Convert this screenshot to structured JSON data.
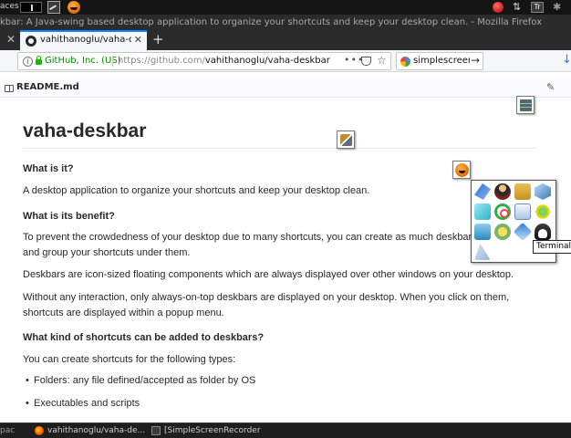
{
  "os_panel": {
    "workspaces_label": "aces",
    "tray": [
      "record-icon",
      "network-icon",
      "keyboard-icon",
      "bluetooth-icon"
    ],
    "keyboard_layout": "Tr"
  },
  "window": {
    "title": "kbar: A Java-swing based desktop application to organize your shortcuts and keep your desktop clean. - Mozilla Firefox"
  },
  "tabs": [
    {
      "title": "vahithanoglu/vaha-deskb",
      "active": true
    }
  ],
  "nav": {
    "identity": "GitHub, Inc. (US)",
    "url_host": "https://github.com/",
    "url_path": "vahithanoglu/vaha-deskbar",
    "page_actions": "•••",
    "search_value": "simplescreenrecorder"
  },
  "readme": {
    "filename": "README.md",
    "title": "vaha-deskbar",
    "sections": [
      {
        "heading": "What is it?",
        "paragraphs": [
          "A desktop application to organize your shortcuts and keep your desktop clean."
        ]
      },
      {
        "heading": "What is its benefit?",
        "paragraphs": [
          "To prevent the crowdedness of your desktop due to many shortcuts, you can create as much deskbars as you want and group your shortcuts under them.",
          "Deskbars are icon-sized floating components which are always displayed over other windows on your desktop.",
          "Without any interaction, only always-on-top deskbars are displayed on your desktop. When you click on them, shortcuts are displayed within a popup menu."
        ]
      },
      {
        "heading": "What kind of shortcuts can be added to deskbars?",
        "paragraphs": [
          "You can create shortcuts for the following types:"
        ],
        "bullets": [
          "Folders: any file defined/accepted as folder by OS",
          "Executables and scripts"
        ]
      }
    ]
  },
  "deskbars": {
    "popup_tooltip": "Terminal",
    "popup_icons": [
      "dev-tools-icon",
      "user-avatar-icon",
      "archive-icon",
      "virtualbox-cube-icon",
      "box-3d-icon",
      "qt-creator-icon",
      "text-editor-icon",
      "filezilla-icon",
      "file-manager-icon",
      "chrome-like-icon",
      "blue-app-icon",
      "terminal-tux-icon",
      "inkscape-icon"
    ]
  },
  "taskbar": {
    "workspace_label": "pac",
    "items": [
      "vahithanoglu/vaha-de...",
      "[SimpleScreenRecorder]"
    ]
  }
}
